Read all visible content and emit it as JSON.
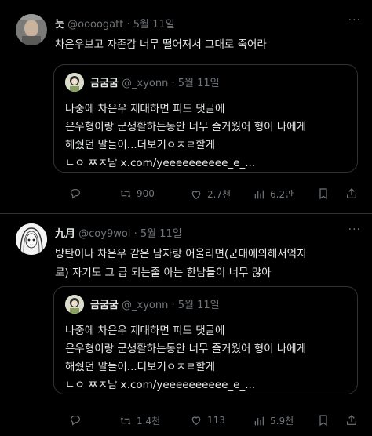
{
  "posts": [
    {
      "author_name": "늣",
      "handle": "@oooogatt",
      "dot": "·",
      "date": "5월 11일",
      "more": "···",
      "text": "차은우보고 자존감 너무 떨어져서 그대로 죽어라",
      "quote": {
        "author_name": "금굼굼",
        "handle": "@_xyonn",
        "dot": "·",
        "date": "5월 11일",
        "lines": [
          "나중에 차은우 제대하면 피드 댓글에",
          "은우형이랑 군생활하는동안 너무 즐거웠어 형이 나에게",
          "해줬던 말들이...더보기ㅇㅈㄹ할게",
          "ㄴㅇ ㅉㅈ남 x.com/yeeeeeeeeee_e_..."
        ]
      },
      "actions": {
        "replies": "",
        "reposts": "900",
        "likes": "2.7천",
        "views": "6.2만"
      }
    },
    {
      "author_name": "九月",
      "handle": "@coy9wol",
      "dot": "·",
      "date": "5월 11일",
      "more": "···",
      "text_lines": [
        "방탄이나 차은우 같은 남자랑 어울리면(군대에의해서억지",
        "로) 자기도 그 급 되는줄 아는 한남들이 너무 많아"
      ],
      "quote": {
        "author_name": "금굼굼",
        "handle": "@_xyonn",
        "dot": "·",
        "date": "5월 11일",
        "lines": [
          "나중에 차은우 제대하면 피드 댓글에",
          "은우형이랑 군생활하는동안 너무 즐거웠어 형이 나에게",
          "해줬던 말들이...더보기ㅇㅈㄹ할게",
          "ㄴㅇ ㅉㅈ남 x.com/yeeeeeeeeee_e_..."
        ]
      },
      "actions": {
        "replies": "",
        "reposts": "1.4천",
        "likes": "113",
        "views": "5.9천"
      }
    }
  ],
  "colors": {
    "background": "#000000",
    "text": "#e7e9ea",
    "muted": "#71767b",
    "border": "#2f3336"
  },
  "icons": [
    "reply-icon",
    "repost-icon",
    "like-icon",
    "views-icon",
    "bookmark-icon",
    "share-icon"
  ]
}
